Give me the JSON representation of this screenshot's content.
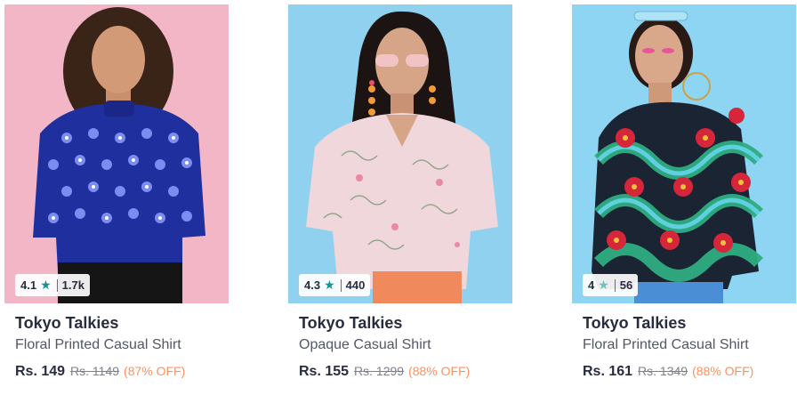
{
  "products": [
    {
      "rating": "4.1",
      "rating_count": "1.7k",
      "brand": "Tokyo Talkies",
      "name": "Floral Printed Casual Shirt",
      "price": "Rs. 149",
      "mrp": "Rs. 1149",
      "discount": "(87% OFF)",
      "image_bg": "#f3b6c6",
      "shirt_color": "#1f2f9e"
    },
    {
      "rating": "4.3",
      "rating_count": "440",
      "brand": "Tokyo Talkies",
      "name": "Opaque Casual Shirt",
      "price": "Rs. 155",
      "mrp": "Rs. 1299",
      "discount": "(88% OFF)",
      "image_bg": "#8fd1ee",
      "shirt_color": "#efd7dc"
    },
    {
      "rating": "4",
      "rating_count": "56",
      "brand": "Tokyo Talkies",
      "name": "Floral Printed Casual Shirt",
      "price": "Rs. 161",
      "mrp": "Rs. 1349",
      "discount": "(88% OFF)",
      "image_bg": "#8dd5f3",
      "shirt_color": "#1b2433"
    }
  ],
  "icons": {
    "star": "star-icon"
  },
  "colors": {
    "rating_star": "#14958f",
    "discount": "#ff905a",
    "brand_text": "#282c3f"
  }
}
